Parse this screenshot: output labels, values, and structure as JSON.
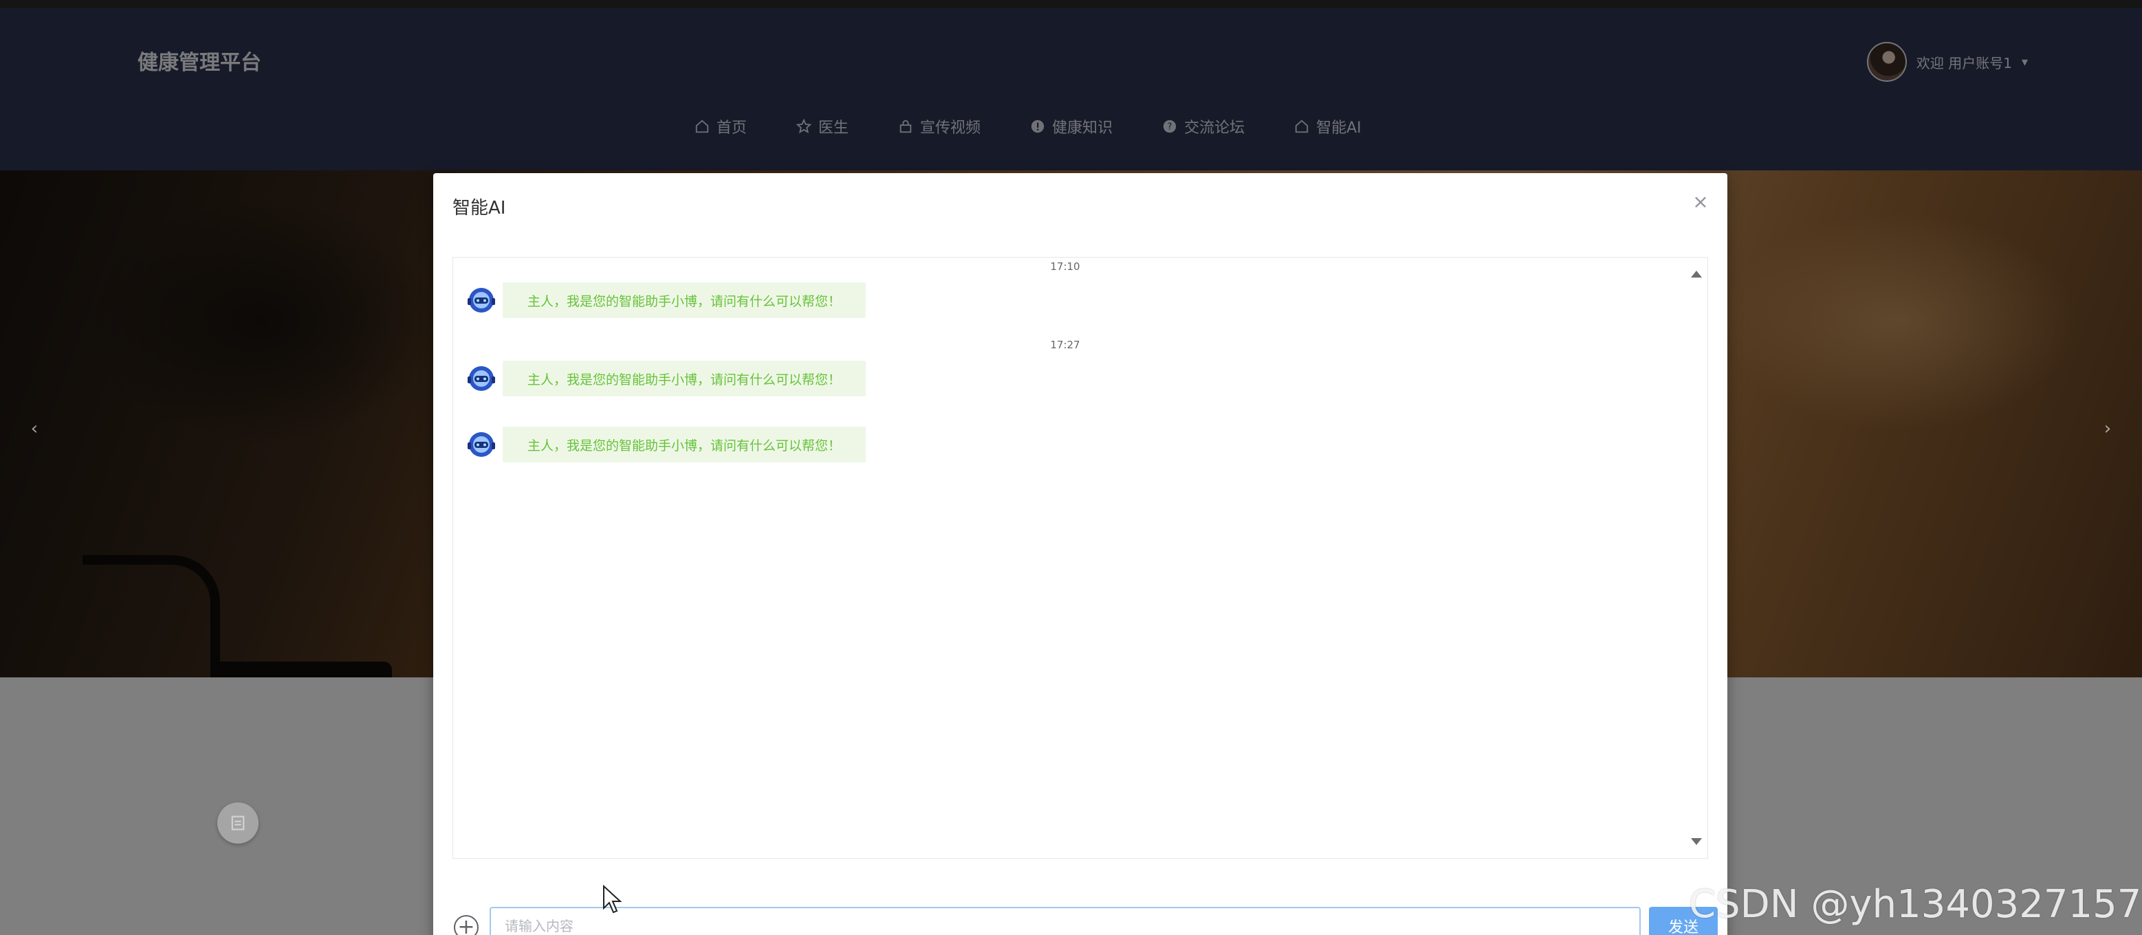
{
  "header": {
    "brand": "健康管理平台",
    "user_text": "欢迎 用户账号1",
    "nav": [
      {
        "label": "首页",
        "icon": "home-icon"
      },
      {
        "label": "医生",
        "icon": "star-icon"
      },
      {
        "label": "宣传视频",
        "icon": "lock-icon"
      },
      {
        "label": "健康知识",
        "icon": "info-icon"
      },
      {
        "label": "交流论坛",
        "icon": "question-icon"
      },
      {
        "label": "智能AI",
        "icon": "home-icon"
      }
    ]
  },
  "carousel": {
    "prev": "‹",
    "next": "›"
  },
  "dialog": {
    "title": "智能AI",
    "close": "×",
    "messages": [
      {
        "time": "17:10",
        "text": "主人，我是您的智能助手小博，请问有什么可以帮您！"
      },
      {
        "time": "17:27",
        "text": "主人，我是您的智能助手小博，请问有什么可以帮您！"
      },
      {
        "time": "",
        "text": "主人，我是您的智能助手小博，请问有什么可以帮您！"
      }
    ],
    "input_placeholder": "请输入内容",
    "plus": "+",
    "send_label": "发送"
  },
  "watermark": "CSDN @yh1340327157",
  "colors": {
    "header_bg": "#2f3452",
    "bubble_bg": "#eef7e6",
    "bubble_text": "#67c23a",
    "send_button": "#66a8f2"
  }
}
